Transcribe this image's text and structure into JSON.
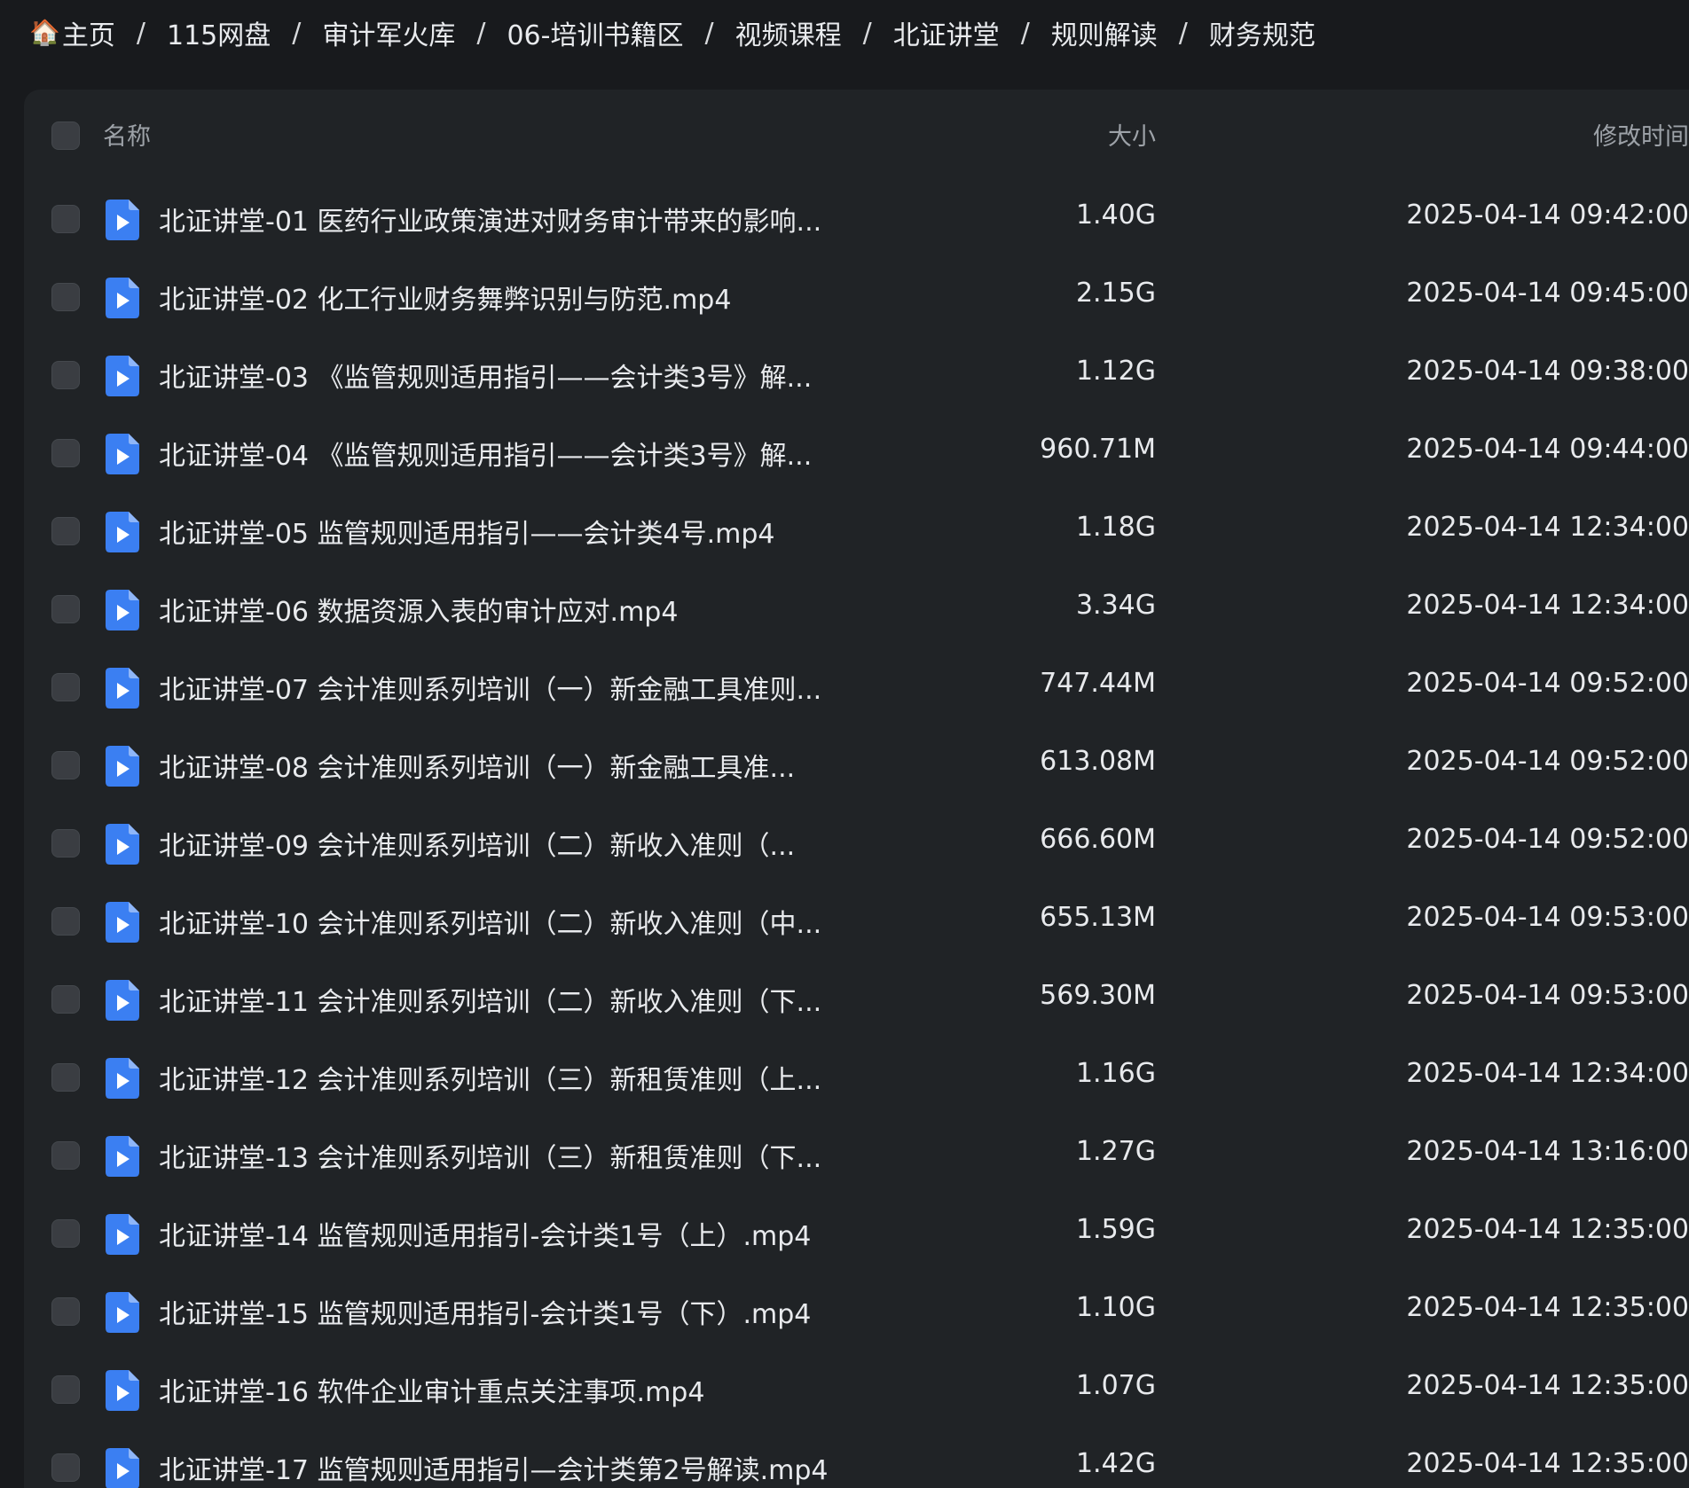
{
  "breadcrumb": {
    "home_icon": "🏠",
    "items": [
      "主页",
      "115网盘",
      "审计军火库",
      "06-培训书籍区",
      "视频课程",
      "北证讲堂",
      "规则解读",
      "财务规范"
    ],
    "separator": "/"
  },
  "table": {
    "columns": {
      "name": "名称",
      "size": "大小",
      "modified": "修改时间"
    },
    "rows": [
      {
        "name": "北证讲堂-01 医药行业政策演进对财务审计带来的影响...",
        "size": "1.40G",
        "modified": "2025-04-14 09:42:00"
      },
      {
        "name": "北证讲堂-02 化工行业财务舞弊识别与防范.mp4",
        "size": "2.15G",
        "modified": "2025-04-14 09:45:00"
      },
      {
        "name": "北证讲堂-03 《监管规则适用指引——会计类3号》解...",
        "size": "1.12G",
        "modified": "2025-04-14 09:38:00"
      },
      {
        "name": "北证讲堂-04 《监管规则适用指引——会计类3号》解...",
        "size": "960.71M",
        "modified": "2025-04-14 09:44:00"
      },
      {
        "name": "北证讲堂-05 监管规则适用指引——会计类4号.mp4",
        "size": "1.18G",
        "modified": "2025-04-14 12:34:00"
      },
      {
        "name": "北证讲堂-06 数据资源入表的审计应对.mp4",
        "size": "3.34G",
        "modified": "2025-04-14 12:34:00"
      },
      {
        "name": "北证讲堂-07 会计准则系列培训（一）新金融工具准则...",
        "size": "747.44M",
        "modified": "2025-04-14 09:52:00"
      },
      {
        "name": "北证讲堂-08 会计准则系列培训（一）新金融工具准...",
        "size": "613.08M",
        "modified": "2025-04-14 09:52:00"
      },
      {
        "name": "北证讲堂-09 会计准则系列培训（二）新收入准则（...",
        "size": "666.60M",
        "modified": "2025-04-14 09:52:00"
      },
      {
        "name": "北证讲堂-10 会计准则系列培训（二）新收入准则（中...",
        "size": "655.13M",
        "modified": "2025-04-14 09:53:00"
      },
      {
        "name": "北证讲堂-11 会计准则系列培训（二）新收入准则（下...",
        "size": "569.30M",
        "modified": "2025-04-14 09:53:00"
      },
      {
        "name": "北证讲堂-12 会计准则系列培训（三）新租赁准则（上...",
        "size": "1.16G",
        "modified": "2025-04-14 12:34:00"
      },
      {
        "name": "北证讲堂-13 会计准则系列培训（三）新租赁准则（下...",
        "size": "1.27G",
        "modified": "2025-04-14 13:16:00"
      },
      {
        "name": "北证讲堂-14 监管规则适用指引-会计类1号（上）.mp4",
        "size": "1.59G",
        "modified": "2025-04-14 12:35:00"
      },
      {
        "name": "北证讲堂-15 监管规则适用指引-会计类1号（下）.mp4",
        "size": "1.10G",
        "modified": "2025-04-14 12:35:00"
      },
      {
        "name": "北证讲堂-16 软件企业审计重点关注事项.mp4",
        "size": "1.07G",
        "modified": "2025-04-14 12:35:00"
      },
      {
        "name": "北证讲堂-17 监管规则适用指引—会计类第2号解读.mp4",
        "size": "1.42G",
        "modified": "2025-04-14 12:35:00"
      }
    ]
  },
  "icons": {
    "file": "video-file-icon",
    "home": "home-icon"
  },
  "colors": {
    "background": "#181a1d",
    "panel": "#202326",
    "file_icon": "#3b7ff2",
    "text": "#e8eaed",
    "header_text": "#9da2a8"
  }
}
